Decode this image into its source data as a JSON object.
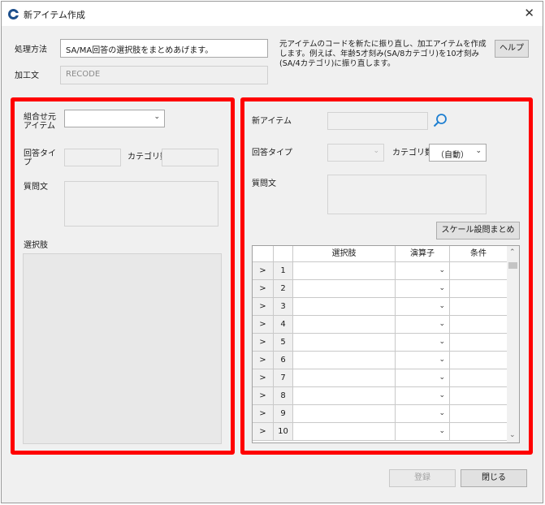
{
  "window": {
    "title": "新アイテム作成",
    "close_glyph": "✕"
  },
  "top": {
    "method_label": "処理方法",
    "method_value": "SA/MA回答の選択肢をまとめあげます。",
    "kakou_label": "加工文",
    "kakou_value": "RECODE",
    "description": "元アイテムのコードを新たに振り直し、加工アイテムを作成します。例えば、年齢5才刻み(SA/8カテゴリ)を10才刻み(SA/4カテゴリ)に振り直します。",
    "help_label": "ヘルプ"
  },
  "left_panel": {
    "source_item_label": "組合せ元アイテム",
    "answer_type_label": "回答タイプ",
    "category_count_label": "カテゴリ数",
    "question_label": "質問文",
    "choices_label": "選択肢"
  },
  "right_panel": {
    "new_item_label": "新アイテム",
    "answer_type_label": "回答タイプ",
    "category_count_label": "カテゴリ数",
    "category_count_value": "（自動）",
    "question_label": "質問文",
    "scale_button_label": "スケール設問まとめ",
    "grid": {
      "headers": [
        "選択肢",
        "演算子",
        "条件"
      ],
      "row_marker": ">",
      "rows": [
        "1",
        "2",
        "3",
        "4",
        "5",
        "6",
        "7",
        "8",
        "9",
        "10"
      ]
    }
  },
  "footer": {
    "register_label": "登録",
    "close_label": "閉じる"
  },
  "colors": {
    "highlight": "#ff0000",
    "icon_blue": "#1d4f8c",
    "search_blue": "#1e7fd1"
  },
  "icons": [
    "app-logo-icon",
    "close-icon",
    "search-icon",
    "chevron-down-icon",
    "scroll-up-icon",
    "scroll-down-icon"
  ]
}
